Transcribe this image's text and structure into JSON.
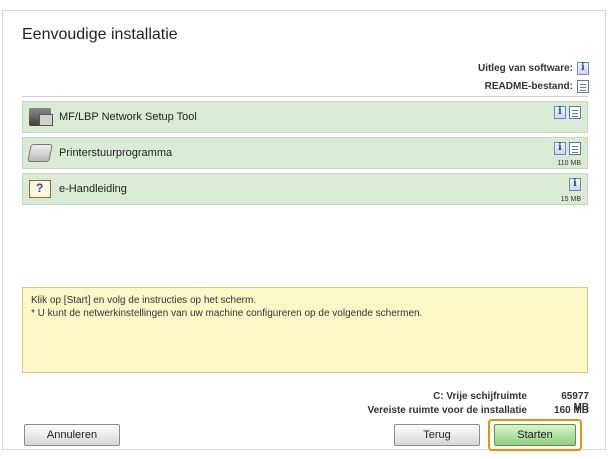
{
  "window": {
    "title": "Eenvoudige installatie"
  },
  "legend": {
    "software_label": "Uitleg van software:",
    "readme_label": "README-bestand:"
  },
  "items": [
    {
      "label": "MF/LBP Network Setup Tool",
      "size": ""
    },
    {
      "label": "Printerstuurprogramma",
      "size": "110 MB"
    },
    {
      "label": "e-Handleiding",
      "size": "15 MB"
    }
  ],
  "message": {
    "line1": "Klik op [Start] en volg de instructies op het scherm.",
    "line2": "* U kunt de netwerkinstellingen van uw machine configureren op de volgende schermen."
  },
  "disk": {
    "free_label": "C: Vrije schijfruimte",
    "free_value": "65977 MB",
    "required_label": "Vereiste ruimte voor de installatie",
    "required_value": "160 MB"
  },
  "buttons": {
    "cancel": "Annuleren",
    "back": "Terug",
    "start": "Starten"
  },
  "colors": {
    "list_item_bg": "#d9ebd5",
    "message_bg": "#fbf7c6",
    "focus_outline": "#f28a16",
    "start_button": "#8fcf7a"
  }
}
